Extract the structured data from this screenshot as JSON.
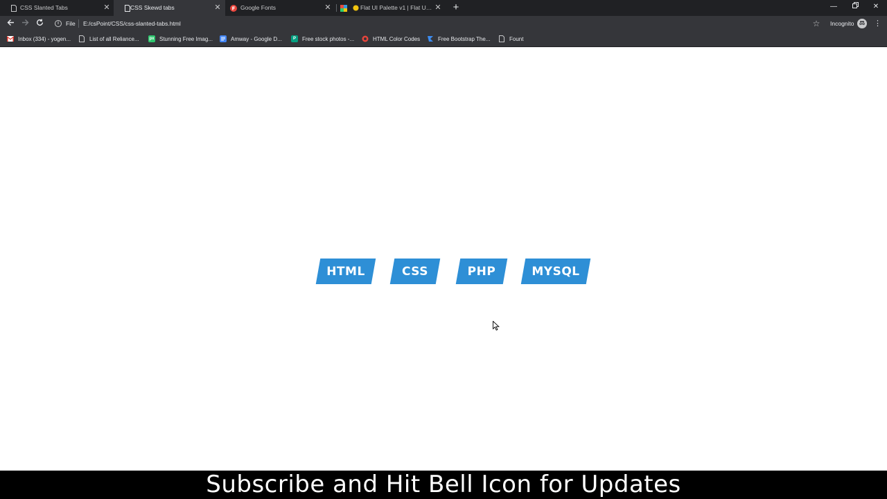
{
  "browser": {
    "tabs": [
      {
        "title": "CSS Slanted Tabs",
        "icon": "page-icon",
        "active": false
      },
      {
        "title": "CSS Skewd tabs",
        "icon": "page-icon",
        "active": true
      },
      {
        "title": "Google Fonts",
        "icon": "google-fonts-icon",
        "active": false
      },
      {
        "title": "Flat UI Palette v1 | Flat UI Col",
        "icon": "flat-ui-icon",
        "active": false
      }
    ],
    "address": {
      "scheme_label": "File",
      "url": "E:/csPoint/CSS/css-slanted-tabs.html"
    },
    "incognito_label": "Incognito",
    "bookmarks": [
      {
        "label": "Inbox (334) - yogen...",
        "icon": "gmail-icon",
        "color": "#d93025"
      },
      {
        "label": "List of all Reliance...",
        "icon": "page-icon",
        "color": "#9aa0a6"
      },
      {
        "label": "Stunning Free Imag...",
        "icon": "pixabay-icon",
        "color": "#2ec66e"
      },
      {
        "label": "Amway - Google D...",
        "icon": "google-docs-icon",
        "color": "#4285f4"
      },
      {
        "label": "Free stock photos -...",
        "icon": "pexels-icon",
        "color": "#05a081"
      },
      {
        "label": "HTML Color Codes",
        "icon": "color-codes-icon",
        "color": "#e8453c"
      },
      {
        "label": "Free Bootstrap The...",
        "icon": "bootstrap-icon",
        "color": "#3c8cf0"
      },
      {
        "label": "Fount",
        "icon": "page-icon",
        "color": "#9aa0a6"
      }
    ]
  },
  "content": {
    "tabs": [
      {
        "label": "HTML"
      },
      {
        "label": "CSS"
      },
      {
        "label": "PHP"
      },
      {
        "label": "MYSQL"
      }
    ],
    "tab_color": "#2e8fd6"
  },
  "caption": {
    "text": "Subscribe and Hit Bell Icon for Updates"
  }
}
